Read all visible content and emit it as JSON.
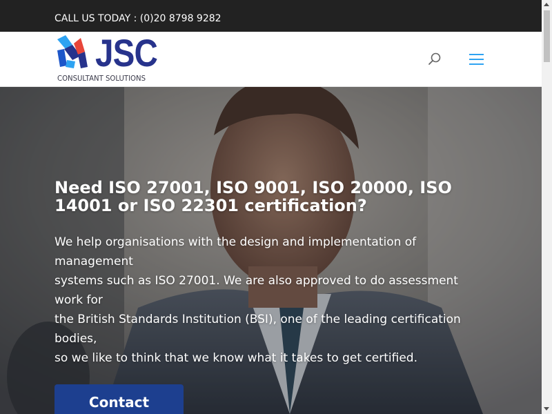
{
  "top_bar": {
    "phone_text": "CALL US TODAY : (0)20 8798 9282"
  },
  "header": {
    "logo": {
      "wordmark": "JSC",
      "tagline": "CONSULTANT SOLUTIONS"
    },
    "search_icon": "search-icon",
    "menu_icon": "hamburger-menu-icon"
  },
  "hero": {
    "title": "Need ISO 27001, ISO 9001, ISO 20000, ISO 14001 or ISO 22301 certification?",
    "text_lines": [
      "We help organisations with the design and implementation of management",
      "systems such as ISO 27001. We are also approved to do assessment work for",
      "the British Standards Institution (BSI), one of the leading certification bodies,",
      "so we like to think that we know what it takes to get certified."
    ],
    "contact_label": "Contact"
  },
  "colors": {
    "top_bar": "#222222",
    "brand_navy": "#27338c",
    "accent_blue": "#2ea3f2",
    "button_blue": "#1d3f8f"
  }
}
